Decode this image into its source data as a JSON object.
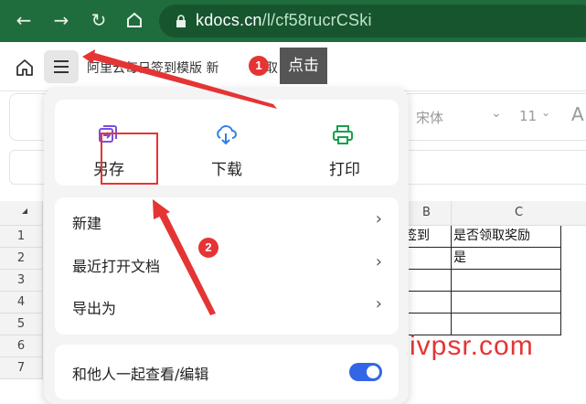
{
  "browser": {
    "url_host": "kdocs.cn",
    "url_path": "/l/cf58rucrCSki"
  },
  "app": {
    "doc_title": "阿里云每日签到模版 新",
    "doc_title_tail": "取",
    "tooltip": "点击"
  },
  "format_toolbar": {
    "font_name": "宋体",
    "font_size": "11",
    "font_icon": "A"
  },
  "sheet": {
    "columns": [
      "B",
      "C"
    ],
    "rows": [
      "1",
      "2",
      "3",
      "4",
      "5",
      "6",
      "7"
    ],
    "cells": {
      "b1": "签到",
      "c1": "是否领取奖励",
      "c2": "是"
    }
  },
  "menu": {
    "quick_actions": [
      {
        "label": "另存",
        "icon": "save-as-icon",
        "color": "#7b4fe0"
      },
      {
        "label": "下载",
        "icon": "cloud-download-icon",
        "color": "#2f7fe6"
      },
      {
        "label": "打印",
        "icon": "printer-icon",
        "color": "#1a9e4c"
      }
    ],
    "items": [
      {
        "label": "新建"
      },
      {
        "label": "最近打开文档"
      },
      {
        "label": "导出为"
      }
    ],
    "collab_label": "和他人一起查看/编辑",
    "collab_enabled": true
  },
  "annotations": {
    "badge1": "1",
    "badge2": "2",
    "color": "#e53434"
  },
  "watermark": "ivpsr.com"
}
